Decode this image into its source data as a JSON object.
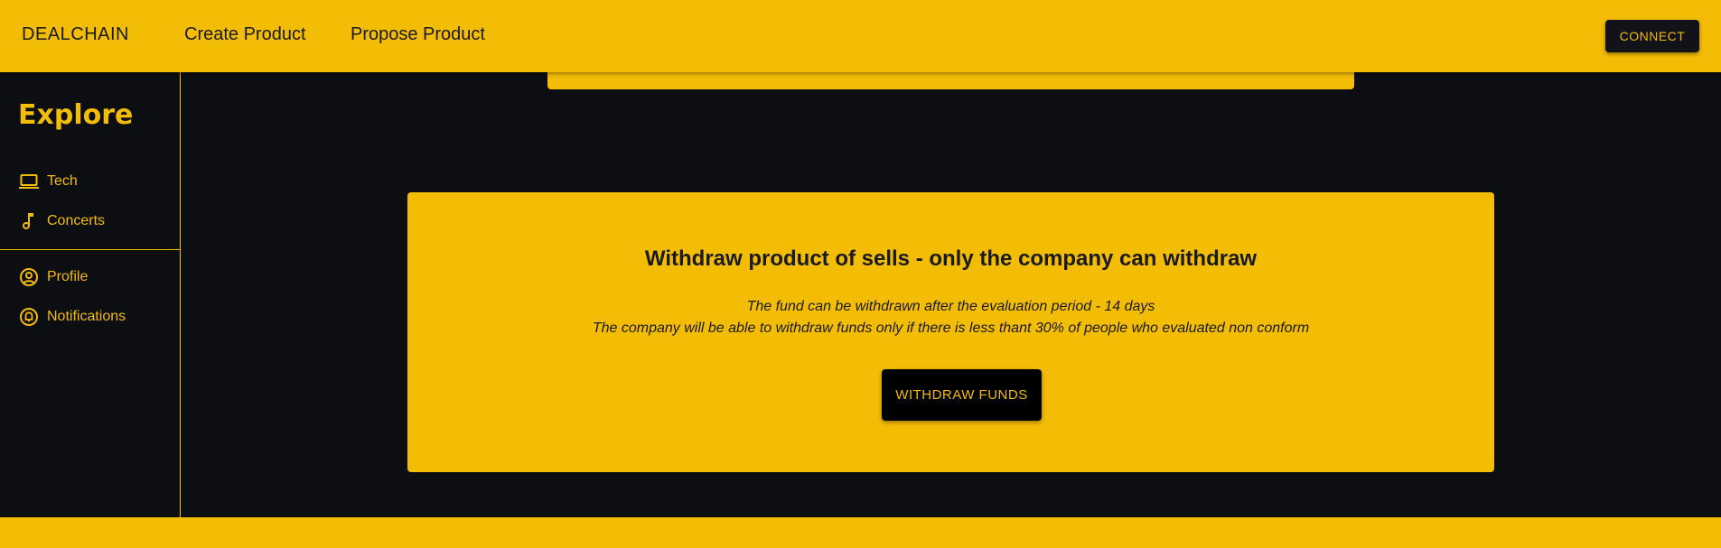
{
  "header": {
    "brand": "DEALCHAIN",
    "nav": [
      {
        "label": "Create Product"
      },
      {
        "label": "Propose Product"
      }
    ],
    "connect_label": "CONNECT"
  },
  "sidebar": {
    "title": "Explore",
    "categories": [
      {
        "label": "Tech",
        "icon": "laptop-icon"
      },
      {
        "label": "Concerts",
        "icon": "music-note-icon"
      }
    ],
    "account": [
      {
        "label": "Profile",
        "icon": "account-circle-icon"
      },
      {
        "label": "Notifications",
        "icon": "bell-circle-icon"
      }
    ]
  },
  "withdraw_card": {
    "title": "Withdraw product of sells - only the company can withdraw",
    "line1": "The fund can be withdrawn after the evaluation period - 14 days",
    "line2": "The company will be able to withdraw funds only if there is less thant 30% of people who evaluated non conform",
    "button_label": "WITHDRAW FUNDS"
  },
  "colors": {
    "accent": "#f3bc05",
    "background": "#0c0e12",
    "button_dark": "#000000"
  }
}
